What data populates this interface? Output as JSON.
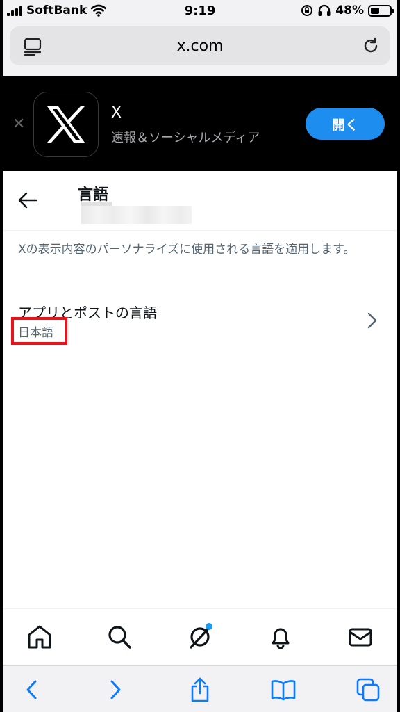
{
  "status_bar": {
    "carrier": "SoftBank",
    "time": "9:19",
    "battery": "48%"
  },
  "browser": {
    "url": "x.com"
  },
  "app_banner": {
    "app_name": "X",
    "subtitle": "速報＆ソーシャルメディア",
    "open_label": "開く"
  },
  "page": {
    "title": "言語",
    "description": "Xの表示内容のパーソナライズに使用される言語を適用します。"
  },
  "setting": {
    "label": "アプリとポストの言語",
    "value": "日本語"
  },
  "colors": {
    "accent": "#1d9bf0",
    "highlight": "#e8141c",
    "safari_blue": "#0a7aff"
  },
  "icons": {
    "bottom_nav": [
      "home-icon",
      "search-icon",
      "grok-icon",
      "notifications-icon",
      "messages-icon"
    ],
    "safari": [
      "back-icon",
      "forward-icon",
      "share-icon",
      "bookmarks-icon",
      "tabs-icon"
    ]
  }
}
